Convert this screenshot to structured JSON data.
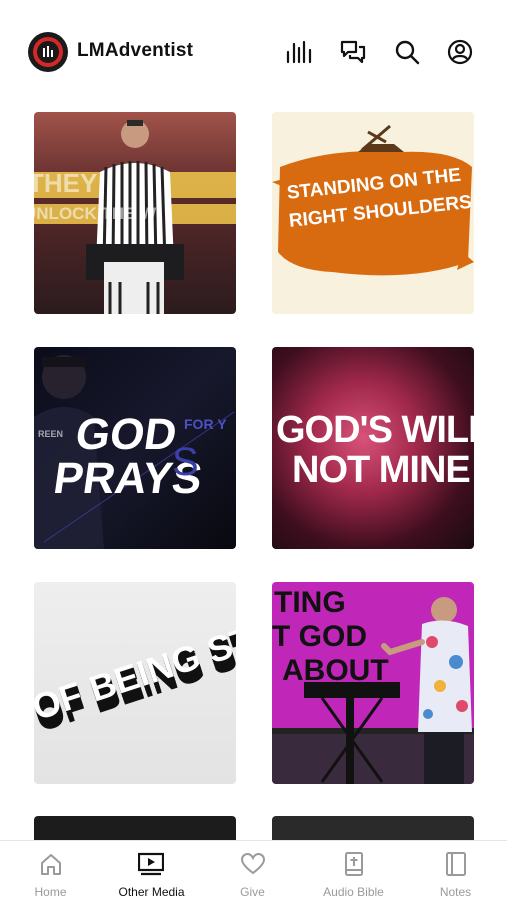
{
  "app": {
    "title": "LMAdventist"
  },
  "header": {
    "icons": [
      "equalizer-icon",
      "chat-bubbles-icon",
      "search-icon",
      "account-icon"
    ]
  },
  "tiles": [
    {
      "text_lines": [
        "THEY",
        "UNLOCK THE W"
      ]
    },
    {
      "text_lines": [
        "STANDING ON THE",
        "RIGHT SHOULDERS"
      ]
    },
    {
      "text_lines": [
        "GOD",
        "PRAYS",
        "FOR Y",
        "S"
      ]
    },
    {
      "text_lines": [
        "GOD'S WILL",
        "NOT MINE"
      ]
    },
    {
      "text_lines": [
        "OF BEING ST"
      ]
    },
    {
      "text_lines": [
        "TING",
        "T GOD",
        "ABOUT"
      ]
    },
    {
      "text_lines": []
    },
    {
      "text_lines": []
    }
  ],
  "tabbar": {
    "items": [
      {
        "label": "Home",
        "icon": "home-icon",
        "active": false
      },
      {
        "label": "Other Media",
        "icon": "video-player-icon",
        "active": true
      },
      {
        "label": "Give",
        "icon": "heart-icon",
        "active": false
      },
      {
        "label": "Audio Bible",
        "icon": "bible-icon",
        "active": false
      },
      {
        "label": "Notes",
        "icon": "notes-icon",
        "active": false
      }
    ]
  }
}
